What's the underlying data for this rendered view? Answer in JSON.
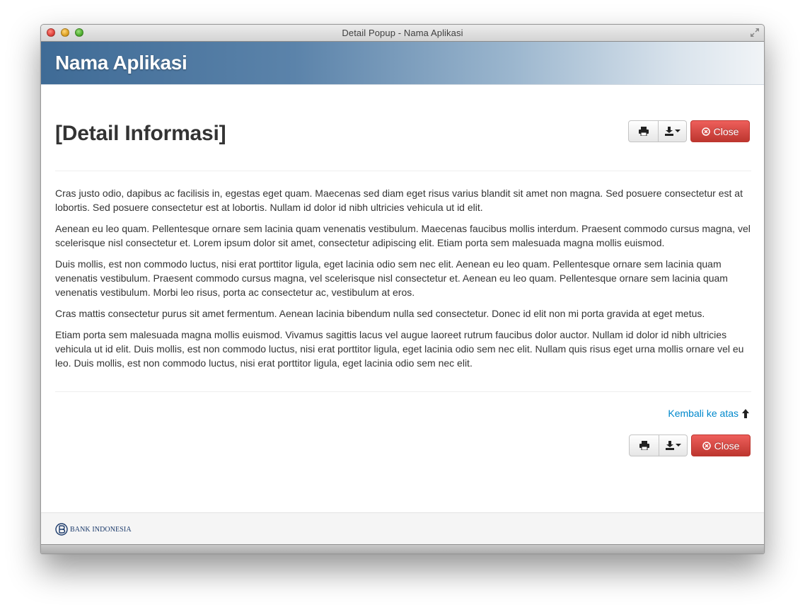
{
  "window": {
    "title": "Detail Popup - Nama Aplikasi"
  },
  "header": {
    "app_name": "Nama Aplikasi",
    "gradient_start": "#3f6b96",
    "gradient_end": "#f1f4f7"
  },
  "page": {
    "title": "[Detail Informasi]"
  },
  "toolbar": {
    "print_icon": "printer-icon",
    "download_icon": "download-icon",
    "close_label": "Close",
    "close_icon": "circle-x-icon",
    "close_color": "#d9534f"
  },
  "content": {
    "paragraphs": [
      "Cras justo odio, dapibus ac facilisis in, egestas eget quam. Maecenas sed diam eget risus varius blandit sit amet non magna. Sed posuere consectetur est at lobortis. Sed posuere consectetur est at lobortis. Nullam id dolor id nibh ultricies vehicula ut id elit.",
      "Aenean eu leo quam. Pellentesque ornare sem lacinia quam venenatis vestibulum. Maecenas faucibus mollis interdum. Praesent commodo cursus magna, vel scelerisque nisl consectetur et. Lorem ipsum dolor sit amet, consectetur adipiscing elit. Etiam porta sem malesuada magna mollis euismod.",
      "Duis mollis, est non commodo luctus, nisi erat porttitor ligula, eget lacinia odio sem nec elit. Aenean eu leo quam. Pellentesque ornare sem lacinia quam venenatis vestibulum. Praesent commodo cursus magna, vel scelerisque nisl consectetur et. Aenean eu leo quam. Pellentesque ornare sem lacinia quam venenatis vestibulum. Morbi leo risus, porta ac consectetur ac, vestibulum at eros.",
      "Cras mattis consectetur purus sit amet fermentum. Aenean lacinia bibendum nulla sed consectetur. Donec id elit non mi porta gravida at eget metus.",
      "Etiam porta sem malesuada magna mollis euismod. Vivamus sagittis lacus vel augue laoreet rutrum faucibus dolor auctor. Nullam id dolor id nibh ultricies vehicula ut id elit. Duis mollis, est non commodo luctus, nisi erat porttitor ligula, eget lacinia odio sem nec elit. Nullam quis risus eget urna mollis ornare vel eu leo. Duis mollis, est non commodo luctus, nisi erat porttitor ligula, eget lacinia odio sem nec elit."
    ]
  },
  "back_to_top": {
    "label": "Kembali ke atas",
    "icon": "arrow-up-icon",
    "color": "#0088cc"
  },
  "footer": {
    "logo_text": "BANK INDONESIA",
    "logo_icon": "bank-indonesia-logo-icon"
  }
}
